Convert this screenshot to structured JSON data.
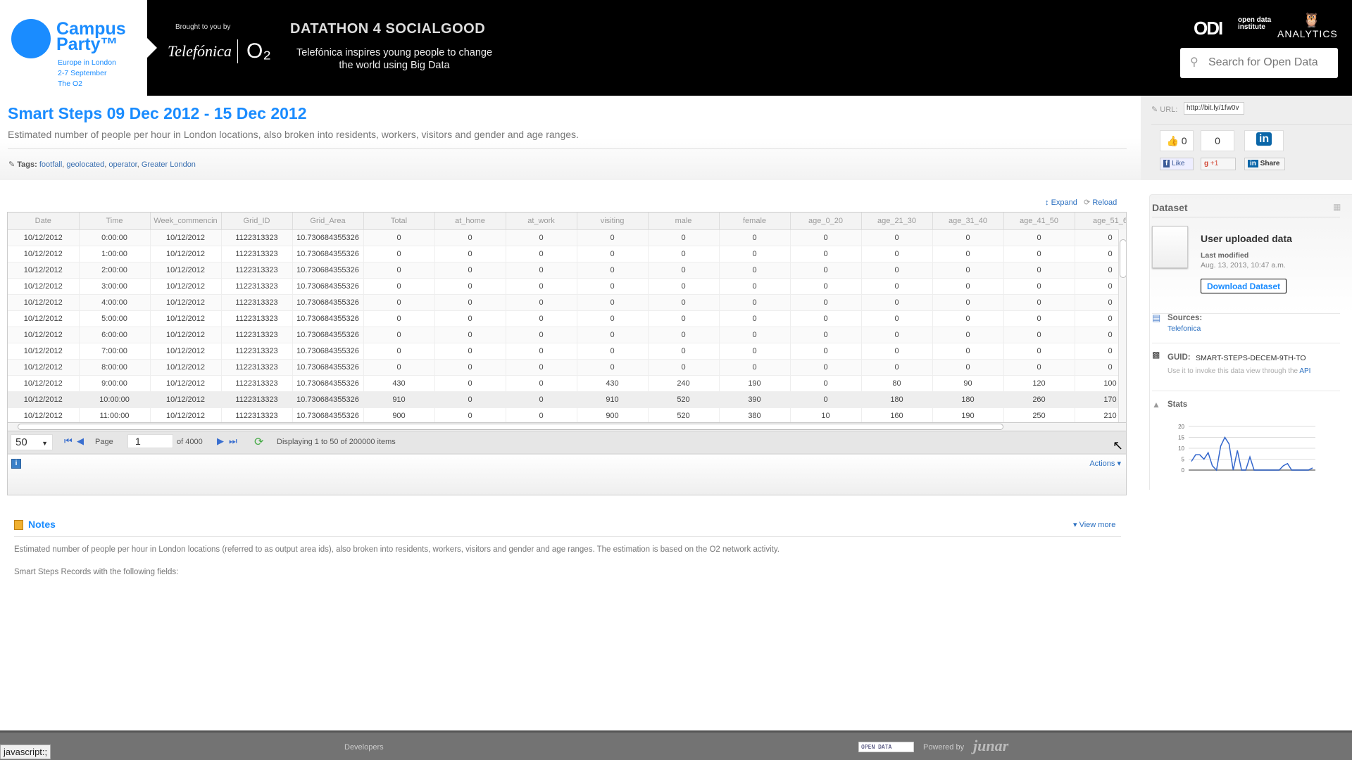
{
  "banner": {
    "campus_party": {
      "name": "Campus Party™",
      "line1": "Europe in London",
      "line2": "2-7 September",
      "line3": "The O2"
    },
    "brought_by": "Brought to you by",
    "sponsor1": "Telefónica",
    "sponsor2": "O₂",
    "event_title": "DATATHON 4 SOCIALGOOD",
    "event_subtitle": "Telefónica inspires young people to change the world using Big Data",
    "odi_logo": "ODI",
    "odi_text": "open data institute",
    "analytics": "ANALYTICS",
    "search_placeholder": "Search for Open Data"
  },
  "page": {
    "title": "Smart Steps 09 Dec 2012 - 15 Dec 2012",
    "subtitle": "Estimated number of people per hour in London locations, also broken into residents, workers, visitors and gender and age ranges.",
    "tags_label": "Tags:",
    "tags": [
      "footfall",
      "geolocated",
      "operator",
      "Greater London"
    ]
  },
  "share": {
    "url_label": "URL:",
    "url_value": "http://bit.ly/1fw0v",
    "fb_count": "0",
    "gplus_count": "0",
    "fb_like": "Like",
    "gplus": "+1",
    "li_share": "Share"
  },
  "grid": {
    "expand": "Expand",
    "reload": "Reload",
    "columns": [
      "Date",
      "Time",
      "Week_commencin",
      "Grid_ID",
      "Grid_Area",
      "Total",
      "at_home",
      "at_work",
      "visiting",
      "male",
      "female",
      "age_0_20",
      "age_21_30",
      "age_31_40",
      "age_41_50",
      "age_51_6"
    ],
    "rows": [
      [
        "10/12/2012",
        "0:00:00",
        "10/12/2012",
        "1122313323",
        "10.730684355326",
        "0",
        "0",
        "0",
        "0",
        "0",
        "0",
        "0",
        "0",
        "0",
        "0",
        "0"
      ],
      [
        "10/12/2012",
        "1:00:00",
        "10/12/2012",
        "1122313323",
        "10.730684355326",
        "0",
        "0",
        "0",
        "0",
        "0",
        "0",
        "0",
        "0",
        "0",
        "0",
        "0"
      ],
      [
        "10/12/2012",
        "2:00:00",
        "10/12/2012",
        "1122313323",
        "10.730684355326",
        "0",
        "0",
        "0",
        "0",
        "0",
        "0",
        "0",
        "0",
        "0",
        "0",
        "0"
      ],
      [
        "10/12/2012",
        "3:00:00",
        "10/12/2012",
        "1122313323",
        "10.730684355326",
        "0",
        "0",
        "0",
        "0",
        "0",
        "0",
        "0",
        "0",
        "0",
        "0",
        "0"
      ],
      [
        "10/12/2012",
        "4:00:00",
        "10/12/2012",
        "1122313323",
        "10.730684355326",
        "0",
        "0",
        "0",
        "0",
        "0",
        "0",
        "0",
        "0",
        "0",
        "0",
        "0"
      ],
      [
        "10/12/2012",
        "5:00:00",
        "10/12/2012",
        "1122313323",
        "10.730684355326",
        "0",
        "0",
        "0",
        "0",
        "0",
        "0",
        "0",
        "0",
        "0",
        "0",
        "0"
      ],
      [
        "10/12/2012",
        "6:00:00",
        "10/12/2012",
        "1122313323",
        "10.730684355326",
        "0",
        "0",
        "0",
        "0",
        "0",
        "0",
        "0",
        "0",
        "0",
        "0",
        "0"
      ],
      [
        "10/12/2012",
        "7:00:00",
        "10/12/2012",
        "1122313323",
        "10.730684355326",
        "0",
        "0",
        "0",
        "0",
        "0",
        "0",
        "0",
        "0",
        "0",
        "0",
        "0"
      ],
      [
        "10/12/2012",
        "8:00:00",
        "10/12/2012",
        "1122313323",
        "10.730684355326",
        "0",
        "0",
        "0",
        "0",
        "0",
        "0",
        "0",
        "0",
        "0",
        "0",
        "0"
      ],
      [
        "10/12/2012",
        "9:00:00",
        "10/12/2012",
        "1122313323",
        "10.730684355326",
        "430",
        "0",
        "0",
        "430",
        "240",
        "190",
        "0",
        "80",
        "90",
        "120",
        "100"
      ],
      [
        "10/12/2012",
        "10:00:00",
        "10/12/2012",
        "1122313323",
        "10.730684355326",
        "910",
        "0",
        "0",
        "910",
        "520",
        "390",
        "0",
        "180",
        "180",
        "260",
        "170"
      ],
      [
        "10/12/2012",
        "11:00:00",
        "10/12/2012",
        "1122313323",
        "10.730684355326",
        "900",
        "0",
        "0",
        "900",
        "520",
        "380",
        "10",
        "160",
        "190",
        "250",
        "210"
      ]
    ],
    "selected_row": 10,
    "pager": {
      "page_size": "50",
      "page_label": "Page",
      "page": "1",
      "of_pages": "of 4000",
      "display": "Displaying 1 to 50 of 200000 items"
    },
    "actions": "Actions"
  },
  "notes": {
    "title": "Notes",
    "view_more": "View more",
    "text1": "Estimated number of people per hour in London locations (referred to as output area ids), also broken into residents, workers, visitors and gender and age ranges. The estimation is based on the O2 network activity.",
    "text2": "Smart Steps Records with the following fields:"
  },
  "dataset": {
    "header": "Dataset",
    "name": "User uploaded data",
    "modified_label": "Last modified",
    "modified": "Aug. 13, 2013, 10:47 a.m.",
    "download": "Download Dataset",
    "sources_label": "Sources:",
    "source": "Telefonica",
    "guid_label": "GUID:",
    "guid": "SMART-STEPS-DECEM-9TH-TO",
    "guid_hint": "Use it to invoke this data view through the",
    "api": "API",
    "stats_label": "Stats",
    "chart_data": {
      "type": "line",
      "yticks": [
        "20",
        "15",
        "10",
        "5",
        "0"
      ],
      "ylim": [
        0,
        20
      ],
      "values": [
        4,
        7,
        7,
        5,
        8,
        2,
        0,
        11,
        15,
        12,
        0,
        9,
        0,
        0,
        6,
        0,
        0,
        0,
        0,
        0,
        0,
        0,
        2,
        3,
        0,
        0,
        0,
        0,
        0,
        1
      ],
      "color": "#3366cc"
    }
  },
  "footer": {
    "developers": "Developers",
    "open_data": "OPEN DATA",
    "powered_by": "Powered by",
    "junar": "junar",
    "status": "javascript:;"
  }
}
